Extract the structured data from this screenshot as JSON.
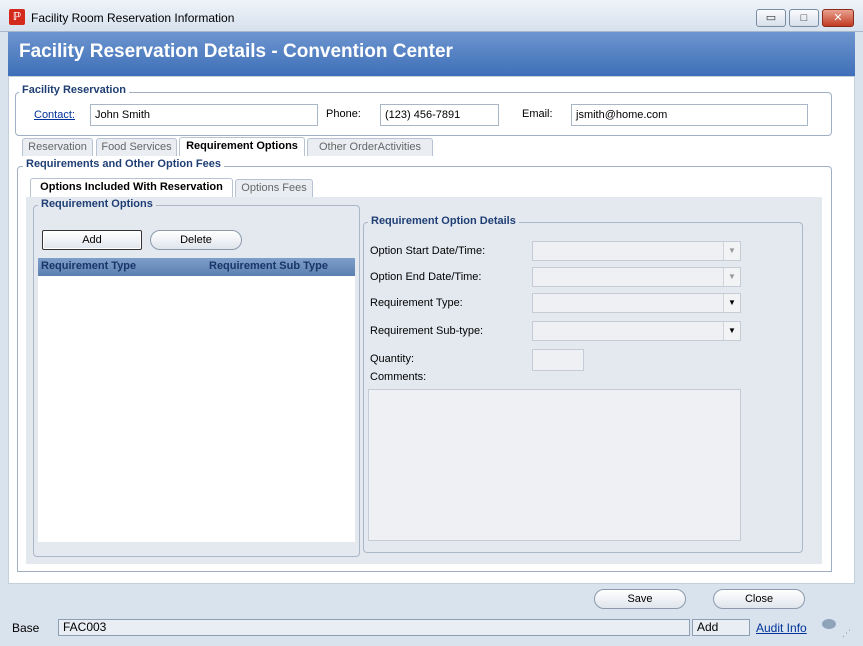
{
  "window": {
    "title": "Facility Room Reservation Information",
    "minimize": "▭",
    "maximize": "□",
    "close": "✕"
  },
  "header": {
    "title": "Facility Reservation Details - Convention Center"
  },
  "facility_reservation": {
    "legend": "Facility Reservation",
    "contact_label": "Contact:",
    "contact_value": "John Smith",
    "phone_label": "Phone:",
    "phone_value": "(123) 456-7891",
    "email_label": "Email:",
    "email_value": "jsmith@home.com"
  },
  "main_tabs": [
    {
      "label": "Reservation",
      "active": false
    },
    {
      "label": "Food Services",
      "active": false
    },
    {
      "label": "Requirement Options",
      "active": true
    },
    {
      "label": "Other OrderActivities",
      "active": false
    }
  ],
  "requirements_group": {
    "legend": "Requirements and Other Option Fees"
  },
  "sub_tabs": [
    {
      "label": "Options Included With Reservation",
      "active": true
    },
    {
      "label": "Options Fees",
      "active": false
    }
  ],
  "requirement_options": {
    "legend": "Requirement Options",
    "add_label": "Add",
    "delete_label": "Delete",
    "columns": [
      "Requirement Type",
      "Requirement Sub Type"
    ],
    "rows": []
  },
  "details": {
    "legend": "Requirement Option Details",
    "start_label": "Option Start Date/Time:",
    "end_label": "Option End Date/Time:",
    "type_label": "Requirement Type:",
    "subtype_label": "Requirement Sub-type:",
    "quantity_label": "Quantity:",
    "comments_label": "Comments:"
  },
  "actions": {
    "save_label": "Save",
    "close_label": "Close"
  },
  "status": {
    "mode": "Base",
    "code": "FAC003",
    "action": "Add",
    "audit_label": "Audit Info"
  }
}
